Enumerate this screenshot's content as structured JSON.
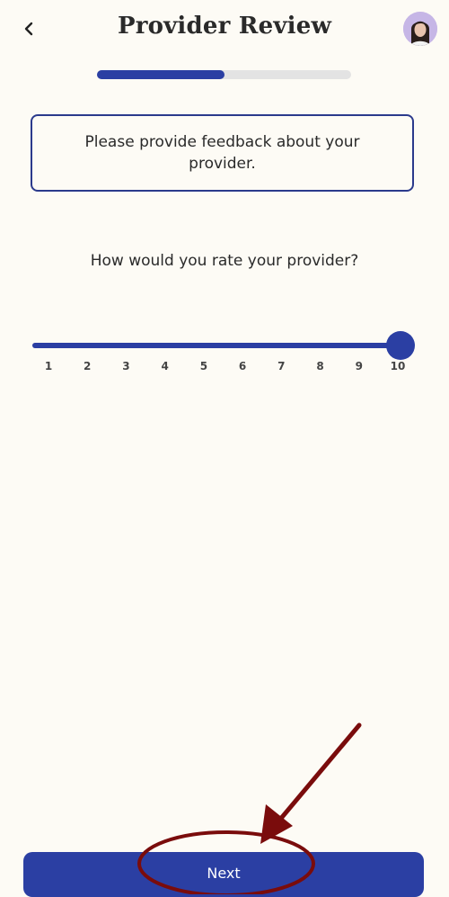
{
  "header": {
    "title": "Provider Review",
    "back_icon": "chevron-left-icon",
    "avatar_icon": "user-avatar"
  },
  "progress": {
    "fraction": 0.5,
    "fill_color": "#2b3fa3",
    "track_color": "#e3e3e3"
  },
  "prompt": {
    "text": "Please provide feedback about your provider."
  },
  "question": {
    "text": "How would you rate your provider?"
  },
  "rating_slider": {
    "min": 1,
    "max": 10,
    "value": 10,
    "ticks": [
      "1",
      "2",
      "3",
      "4",
      "5",
      "6",
      "7",
      "8",
      "9",
      "10"
    ]
  },
  "footer": {
    "next_label": "Next"
  },
  "colors": {
    "accent": "#2b3fa3",
    "background": "#fdfbf5",
    "annotation": "#7a0c0c"
  }
}
